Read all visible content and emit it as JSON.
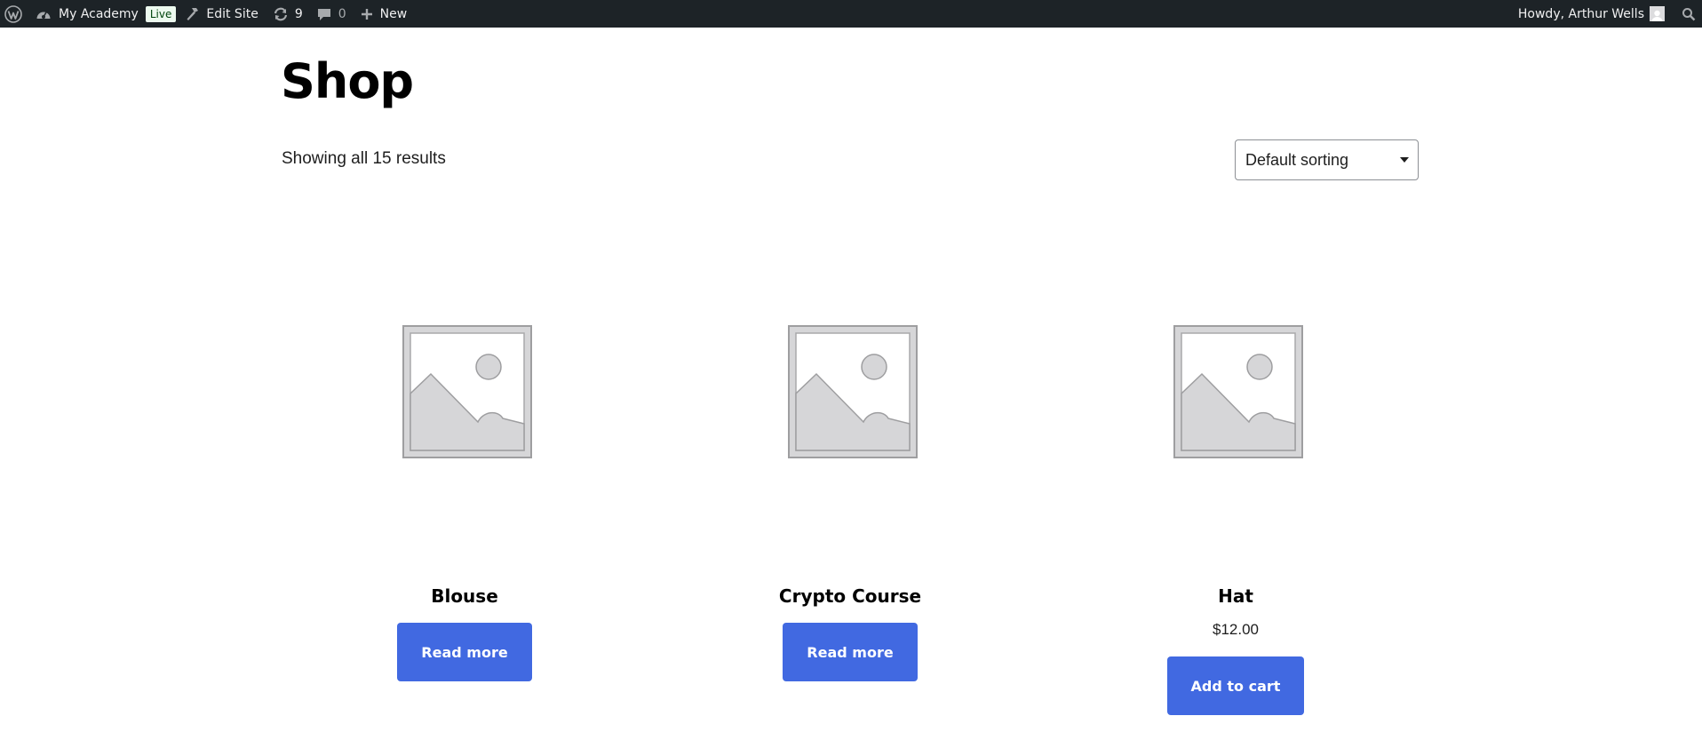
{
  "admin_bar": {
    "site_name": "My Academy",
    "live_badge": "Live",
    "edit_site": "Edit Site",
    "updates_count": "9",
    "comments_count": "0",
    "new_label": "New",
    "howdy": "Howdy, Arthur Wells",
    "icons": [
      "wordpress-icon",
      "dashboard-icon",
      "hammer-icon",
      "updates-icon",
      "comment-icon",
      "plus-icon",
      "avatar",
      "search-icon"
    ]
  },
  "page": {
    "title": "Shop",
    "result_count": "Showing all 15 results",
    "sorting": {
      "selected": "Default sorting"
    }
  },
  "products": [
    {
      "name": "Blouse",
      "price": "",
      "button": "Read more",
      "image": "placeholder-image-icon"
    },
    {
      "name": "Crypto Course",
      "price": "",
      "button": "Read more",
      "image": "placeholder-image-icon"
    },
    {
      "name": "Hat",
      "price": "$12.00",
      "button": "Add to cart",
      "image": "placeholder-image-icon"
    }
  ],
  "colors": {
    "admin_bar_bg": "#1d2327",
    "button_bg": "#4169e1",
    "button_text": "#ffffff",
    "live_badge_bg": "#edfaef"
  }
}
